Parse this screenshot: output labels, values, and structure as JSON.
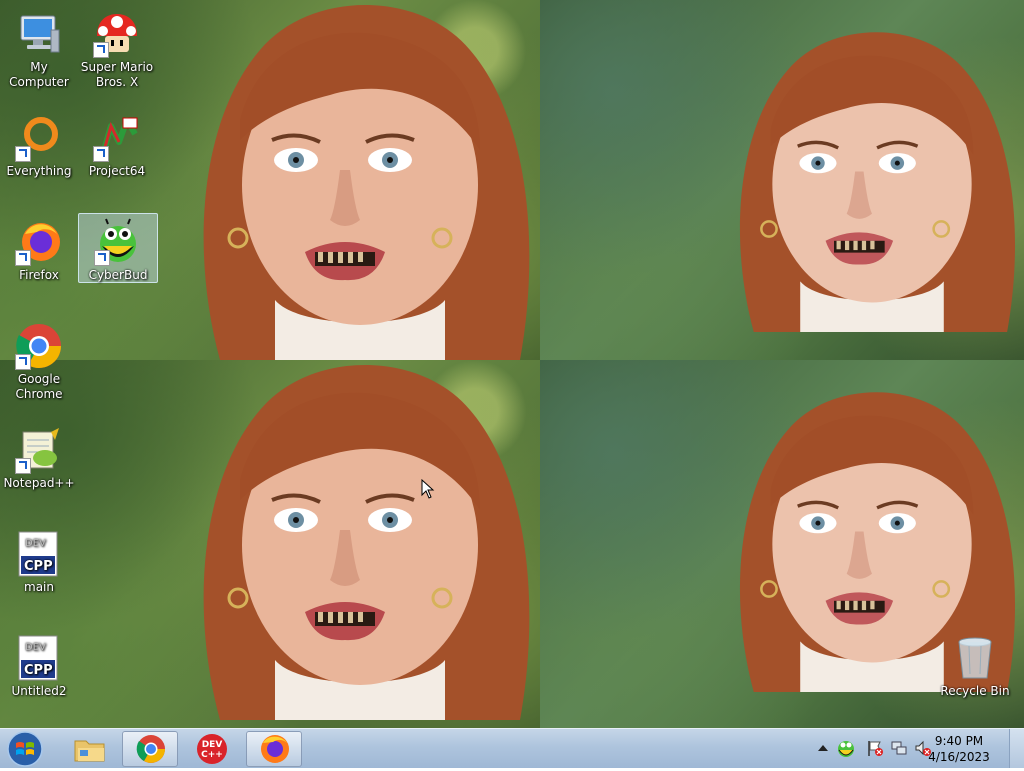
{
  "desktop": {
    "icons": [
      {
        "label": "My Computer"
      },
      {
        "label": "Super Mario Bros. X"
      },
      {
        "label": "Everything"
      },
      {
        "label": "Project64"
      },
      {
        "label": "Firefox"
      },
      {
        "label": "CyberBud"
      },
      {
        "label": "Google Chrome"
      },
      {
        "label": "Notepad++"
      },
      {
        "label": "main"
      },
      {
        "label": "Untitled2"
      },
      {
        "label": "Recycle Bin"
      }
    ],
    "selected_icon": "CyberBud"
  },
  "taskbar": {
    "pinned": [
      "Windows Explorer",
      "Google Chrome",
      "Dev-C++",
      "Firefox"
    ],
    "devcpp_badge": "DEV C++",
    "clock": {
      "time": "9:40 PM",
      "date": "4/16/2023"
    }
  },
  "colors": {
    "taskbar": "#aec4dd",
    "selection": "#c8e1f5",
    "cpp_blue": "#1f3b8c"
  }
}
